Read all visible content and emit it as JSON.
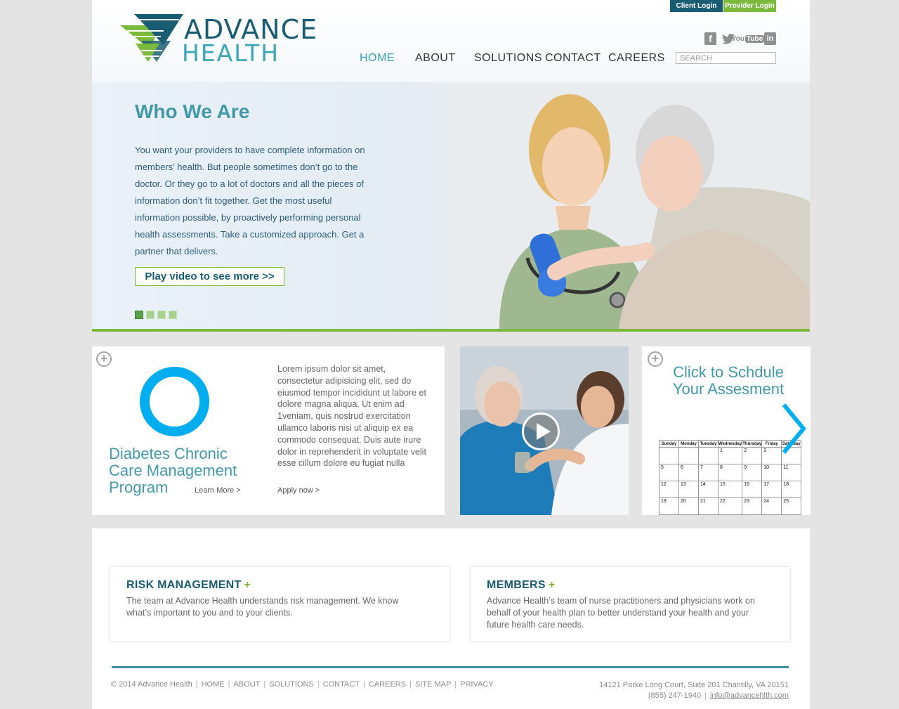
{
  "header": {
    "logo_line1": "ADVANCE",
    "logo_line2": "HEALTH",
    "client_login": "Client Login",
    "provider_login": "Provider Login",
    "social": [
      "facebook-icon",
      "twitter-icon",
      "youtube-icon",
      "linkedin-icon"
    ],
    "youtube_you": "You",
    "youtube_tube": "Tube",
    "search_placeholder": "SEARCH",
    "nav": [
      "HOME",
      "ABOUT",
      "SOLUTIONS",
      "CONTACT",
      "CAREERS"
    ]
  },
  "hero": {
    "title": "Who We Are",
    "text": "You want your providers to have complete information on members’ health. But people sometimes don’t go to the doctor. Or they go to a lot of doctors and all the pieces of information don’t fit together. Get the most useful information possible, by proactively performing personal health assessments. Take a customized approach. Get a partner that delivers.",
    "button": "Play video to see more >>",
    "slides": 4,
    "active_slide": 1
  },
  "diabetes": {
    "title": "Diabetes Chronic Care Management Program",
    "learn_more": "Learn More >",
    "body": "Lorem ipsum dolor sit amet, consectetur adipisicing elit, sed do eiusmod tempor incididunt ut labore et dolore magna aliqua. Ut enim ad 1veniam, quis nostrud exercitation ullamco laboris nisi ut aliquip ex ea commodo consequat. Duis aute irure dolor in reprehenderit in voluptate velit esse cillum dolore eu fugiat nulla",
    "apply": "Apply now >"
  },
  "schedule": {
    "title": "Click to Schdule Your Assesment",
    "days": [
      "Sunday",
      "Monday",
      "Tuesday",
      "Wednesday",
      "Thursday",
      "Friday",
      "Saturday"
    ],
    "weeks": [
      [
        "",
        "",
        "",
        "1",
        "2",
        "3",
        "4"
      ],
      [
        "5",
        "6",
        "7",
        "8",
        "9",
        "10",
        "11"
      ],
      [
        "12",
        "13",
        "14",
        "15",
        "16",
        "17",
        "18"
      ],
      [
        "19",
        "20",
        "21",
        "22",
        "23",
        "24",
        "25"
      ]
    ]
  },
  "risk": {
    "title": "RISK MANAGEMENT",
    "plus": "+",
    "text": "The team at Advance Health understands risk management. We know what’s important to you and to your clients."
  },
  "members": {
    "title": "MEMBERS",
    "plus": "+",
    "text": "Advance Health’s team of nurse practitioners and physicians work on behalf of your health plan to better understand your health and your future health care needs."
  },
  "footer": {
    "copyright": "© 2014 Advance Health",
    "links": [
      "HOME",
      "ABOUT",
      "SOLUTIONS",
      "CONTACT",
      "CAREERS",
      "SITE MAP",
      "PRIVACY"
    ],
    "address": "14121 Parke Long Court, Suite 201 Chantilly, VA 20151",
    "phone": "(855) 247-1940",
    "email": "info@advancehlth.com"
  },
  "colors": {
    "brand_dark": "#1a5d73",
    "brand_teal": "#3aa6b8",
    "brand_green": "#7cba3d",
    "ring_blue": "#00aeef"
  }
}
